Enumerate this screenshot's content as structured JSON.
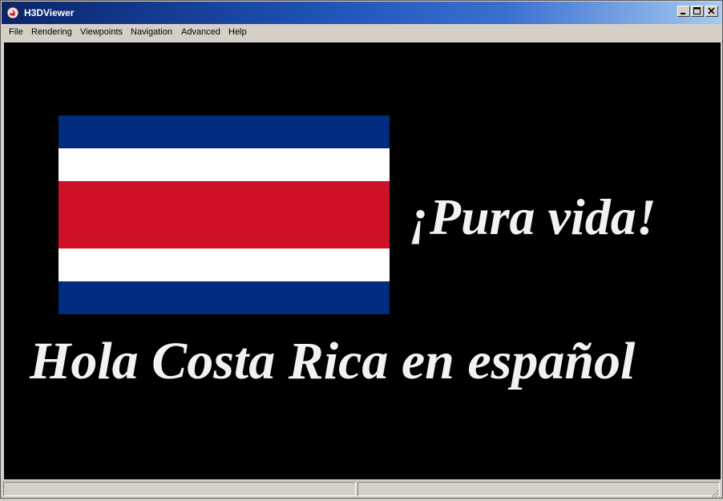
{
  "window": {
    "title": "H3DViewer",
    "icon": "h3d-app-icon",
    "controls": [
      "minimize-icon",
      "maximize-icon",
      "close-icon"
    ]
  },
  "menu": {
    "items": [
      {
        "label": "File"
      },
      {
        "label": "Rendering"
      },
      {
        "label": "Viewpoints"
      },
      {
        "label": "Navigation"
      },
      {
        "label": "Advanced"
      },
      {
        "label": "Help"
      }
    ]
  },
  "scene": {
    "background": "#000000",
    "flag": {
      "name": "Costa Rica flag",
      "colors": {
        "blue": "#002b7f",
        "white": "#ffffff",
        "red": "#ce1126"
      }
    },
    "headline_right": "¡Pura vida!",
    "headline_bottom": "Hola Costa Rica en español",
    "text_color": "#f2f2f2"
  },
  "statusbar": {
    "left_text": "",
    "right_text": ""
  }
}
